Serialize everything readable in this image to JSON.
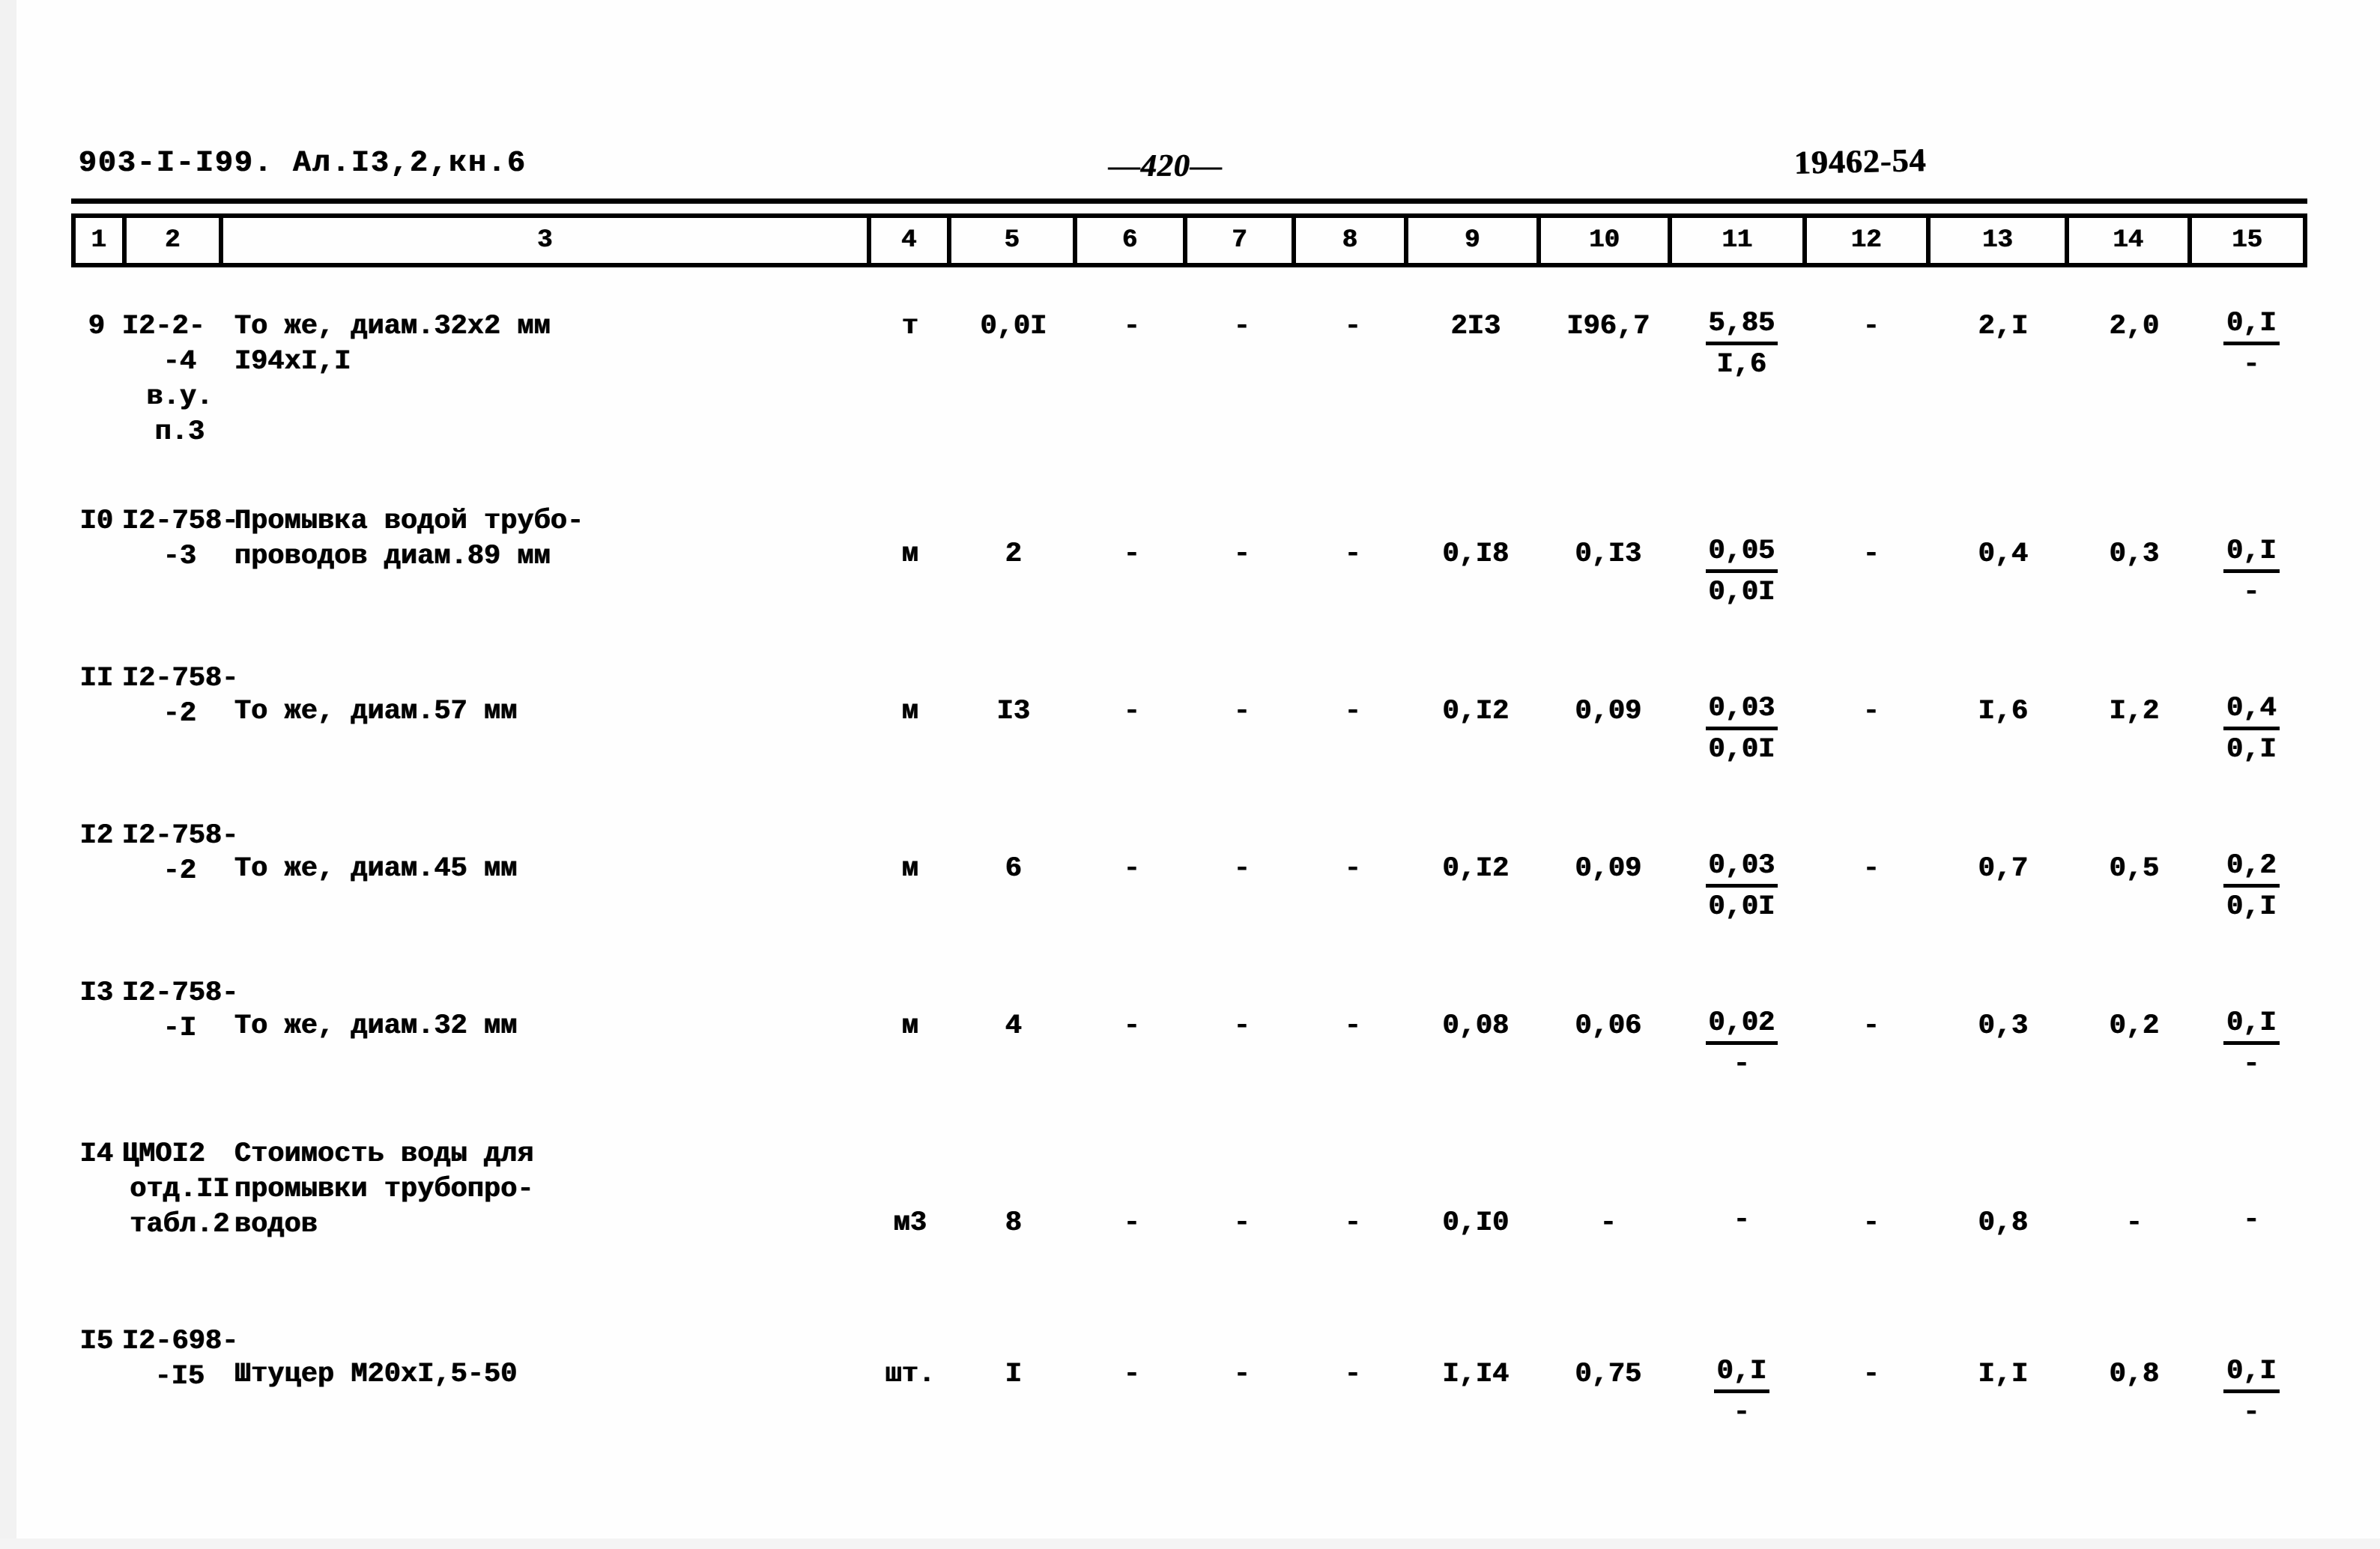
{
  "header": {
    "doc_code": "903-I-I99. Ал.I3,2,кн.6",
    "page_number": "—420—",
    "stamp": "19462-54"
  },
  "table": {
    "column_numbers": [
      "1",
      "2",
      "3",
      "4",
      "5",
      "6",
      "7",
      "8",
      "9",
      "10",
      "11",
      "12",
      "13",
      "14",
      "15"
    ],
    "rows": [
      {
        "no": "9",
        "code_lines": [
          "I2-2-",
          "-4",
          "в.у.",
          "п.3"
        ],
        "desc_lines": [
          "То же, диам.32х2 мм",
          "I94хI,I"
        ],
        "unit": "т",
        "c5": "0,0I",
        "c6": "-",
        "c7": "-",
        "c8": "-",
        "c9": "2I3",
        "c10": "I96,7",
        "c11_num": "5,85",
        "c11_den": "I,6",
        "c12": "-",
        "c13": "2,I",
        "c14": "2,0",
        "c15_num": "0,I",
        "c15_den": "-"
      },
      {
        "no": "I0",
        "code_lines": [
          "I2-758-",
          "-3"
        ],
        "desc_lines": [
          "Промывка водой трубо-",
          "проводов диам.89 мм"
        ],
        "unit": "м",
        "c5": "2",
        "c6": "-",
        "c7": "-",
        "c8": "-",
        "c9": "0,I8",
        "c10": "0,I3",
        "c11_num": "0,05",
        "c11_den": "0,0I",
        "c12": "-",
        "c13": "0,4",
        "c14": "0,3",
        "c15_num": "0,I",
        "c15_den": "-"
      },
      {
        "no": "II",
        "code_lines": [
          "I2-758-",
          "-2"
        ],
        "desc_lines": [
          "То же, диам.57 мм"
        ],
        "unit": "м",
        "c5": "I3",
        "c6": "-",
        "c7": "-",
        "c8": "-",
        "c9": "0,I2",
        "c10": "0,09",
        "c11_num": "0,03",
        "c11_den": "0,0I",
        "c12": "-",
        "c13": "I,6",
        "c14": "I,2",
        "c15_num": "0,4",
        "c15_den": "0,I"
      },
      {
        "no": "I2",
        "code_lines": [
          "I2-758-",
          "-2"
        ],
        "desc_lines": [
          "То же, диам.45 мм"
        ],
        "unit": "м",
        "c5": "6",
        "c6": "-",
        "c7": "-",
        "c8": "-",
        "c9": "0,I2",
        "c10": "0,09",
        "c11_num": "0,03",
        "c11_den": "0,0I",
        "c12": "-",
        "c13": "0,7",
        "c14": "0,5",
        "c15_num": "0,2",
        "c15_den": "0,I"
      },
      {
        "no": "I3",
        "code_lines": [
          "I2-758-",
          "-I"
        ],
        "desc_lines": [
          "То же, диам.32 мм"
        ],
        "unit": "м",
        "c5": "4",
        "c6": "-",
        "c7": "-",
        "c8": "-",
        "c9": "0,08",
        "c10": "0,06",
        "c11_num": "0,02",
        "c11_den": "-",
        "c12": "-",
        "c13": "0,3",
        "c14": "0,2",
        "c15_num": "0,I",
        "c15_den": "-"
      },
      {
        "no": "I4",
        "code_lines": [
          "ЦМОI2",
          "отд.II",
          "табл.2"
        ],
        "desc_lines": [
          "Стоимость воды для",
          "промывки трубопро-",
          "водов"
        ],
        "unit": "м3",
        "c5": "8",
        "c6": "-",
        "c7": "-",
        "c8": "-",
        "c9": "0,I0",
        "c10": "-",
        "c11_num": "-",
        "c11_den": "",
        "c12": "-",
        "c13": "0,8",
        "c14": "-",
        "c15_num": "-",
        "c15_den": ""
      },
      {
        "no": "I5",
        "code_lines": [
          "I2-698-",
          "-I5"
        ],
        "desc_lines": [
          "Штуцер М20хI,5-50"
        ],
        "unit": "шт.",
        "c5": "I",
        "c6": "-",
        "c7": "-",
        "c8": "-",
        "c9": "I,I4",
        "c10": "0,75",
        "c11_num": "0,I",
        "c11_den": "-",
        "c12": "-",
        "c13": "I,I",
        "c14": "0,8",
        "c15_num": "0,I",
        "c15_den": "-"
      }
    ]
  }
}
